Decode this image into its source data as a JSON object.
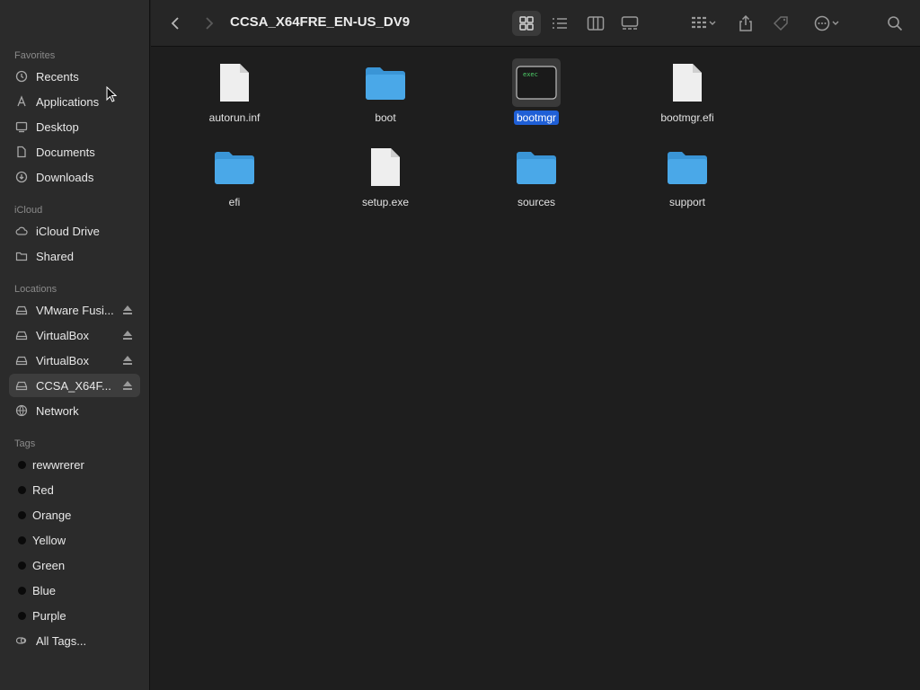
{
  "window": {
    "title": "CCSA_X64FRE_EN-US_DV9"
  },
  "sidebar": {
    "sections": {
      "favorites": "Favorites",
      "icloud": "iCloud",
      "locations": "Locations",
      "tags": "Tags"
    },
    "favorites": [
      {
        "label": "Recents",
        "icon": "clock-icon"
      },
      {
        "label": "Applications",
        "icon": "applications-icon"
      },
      {
        "label": "Desktop",
        "icon": "desktop-icon"
      },
      {
        "label": "Documents",
        "icon": "document-icon"
      },
      {
        "label": "Downloads",
        "icon": "download-icon"
      }
    ],
    "icloud": [
      {
        "label": "iCloud Drive",
        "icon": "cloud-icon"
      },
      {
        "label": "Shared",
        "icon": "shared-folder-icon"
      }
    ],
    "locations": [
      {
        "label": "VMware Fusi...",
        "icon": "disk-icon",
        "eject": true
      },
      {
        "label": "VirtualBox",
        "icon": "disk-icon",
        "eject": true
      },
      {
        "label": "VirtualBox",
        "icon": "disk-icon",
        "eject": true
      },
      {
        "label": "CCSA_X64F...",
        "icon": "disk-icon",
        "eject": true,
        "selected": true
      },
      {
        "label": "Network",
        "icon": "globe-icon"
      }
    ],
    "tags": [
      {
        "label": "rewwrerer"
      },
      {
        "label": "Red"
      },
      {
        "label": "Orange"
      },
      {
        "label": "Yellow"
      },
      {
        "label": "Green"
      },
      {
        "label": "Blue"
      },
      {
        "label": "Purple"
      },
      {
        "label": "All Tags...",
        "icon": "all-tags-icon"
      }
    ]
  },
  "files": [
    {
      "name": "autorun.inf",
      "kind": "document"
    },
    {
      "name": "boot",
      "kind": "folder"
    },
    {
      "name": "bootmgr",
      "kind": "exec",
      "selected": true
    },
    {
      "name": "bootmgr.efi",
      "kind": "document"
    },
    {
      "name": "efi",
      "kind": "folder"
    },
    {
      "name": "setup.exe",
      "kind": "document"
    },
    {
      "name": "sources",
      "kind": "folder"
    },
    {
      "name": "support",
      "kind": "folder"
    }
  ],
  "exec_icon_text": "exec",
  "colors": {
    "folder": "#4aa8e8",
    "selection": "#1f5fd6",
    "sidebar_bg": "#2b2b2b",
    "content_bg": "#1e1e1e"
  }
}
